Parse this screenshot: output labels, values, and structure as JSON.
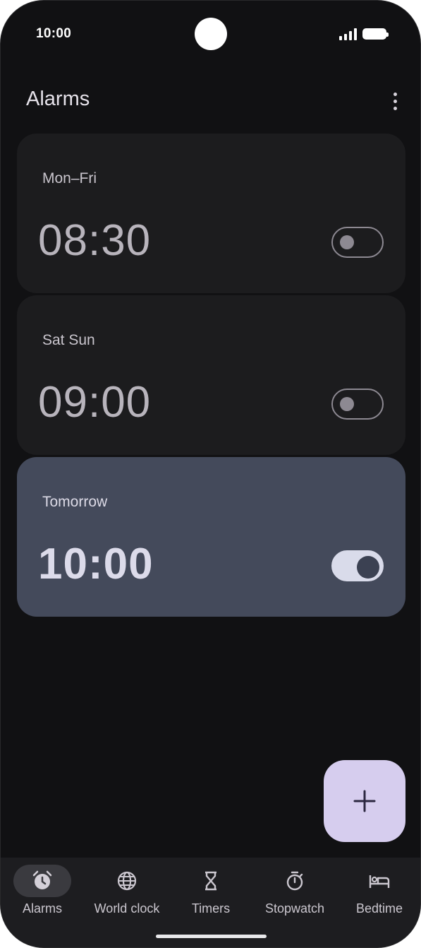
{
  "status_bar": {
    "time": "10:00"
  },
  "header": {
    "title": "Alarms",
    "menu_icon": "more-vert-icon"
  },
  "alarms": [
    {
      "days": "Mon–Fri",
      "time": "08:30",
      "enabled": false
    },
    {
      "days": "Sat Sun",
      "time": "09:00",
      "enabled": false
    },
    {
      "days": "Tomorrow",
      "time": "10:00",
      "enabled": true
    }
  ],
  "fab": {
    "icon": "add-icon"
  },
  "nav": {
    "items": [
      {
        "label": "Alarms",
        "icon": "alarm-icon",
        "active": true
      },
      {
        "label": "World clock",
        "icon": "globe-icon",
        "active": false
      },
      {
        "label": "Timers",
        "icon": "hourglass-icon",
        "active": false
      },
      {
        "label": "Stopwatch",
        "icon": "stopwatch-icon",
        "active": false
      },
      {
        "label": "Bedtime",
        "icon": "bed-icon",
        "active": false
      }
    ]
  },
  "colors": {
    "background": "#111113",
    "card": "#1c1c1e",
    "card_active": "#444a5b",
    "fab": "#d6cdee"
  }
}
